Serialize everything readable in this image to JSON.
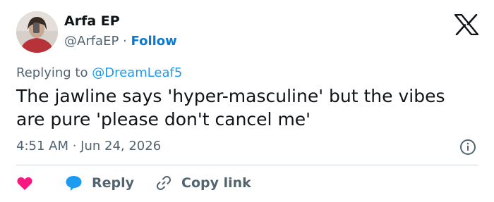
{
  "author": {
    "name": "Arfa EP",
    "handle": "@ArfaEP",
    "separator": "·",
    "follow_label": "Follow"
  },
  "tweet": {
    "replying_prefix": "Replying to",
    "replying_to": "@DreamLeaf5",
    "text": "The jawline says 'hyper-masculine' but the vibes are pure 'please don't cancel me'",
    "timestamp": "4:51 AM · Jun 24, 2026"
  },
  "actions": {
    "reply_label": "Reply",
    "copy_link_label": "Copy link"
  },
  "icons": {
    "logo": "x-logo-icon",
    "info": "info-icon",
    "like": "heart-icon",
    "reply": "speech-bubble-icon",
    "copy": "link-icon"
  },
  "colors": {
    "follow": "#0b7ad0",
    "mention": "#1d9bf0",
    "heart": "#f91880",
    "reply_bubble": "#1d9bf0",
    "muted": "#536471",
    "text": "#0f1419"
  }
}
